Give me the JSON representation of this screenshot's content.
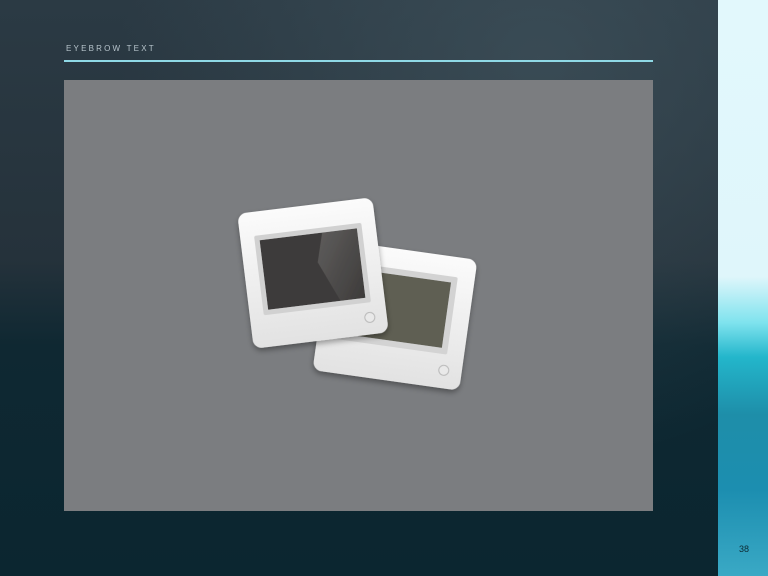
{
  "header": {
    "eyebrow": "EYEBROW TEXT"
  },
  "content": {
    "image_icon": "photo-slides-icon"
  },
  "footer": {
    "page_number": "38"
  },
  "colors": {
    "background": "#25323b",
    "accent_rule": "#8fd9e6",
    "image_placeholder": "#7b7d80",
    "side_panel_top": "#e2f8fc",
    "side_panel_bottom": "#1c8eb0"
  }
}
